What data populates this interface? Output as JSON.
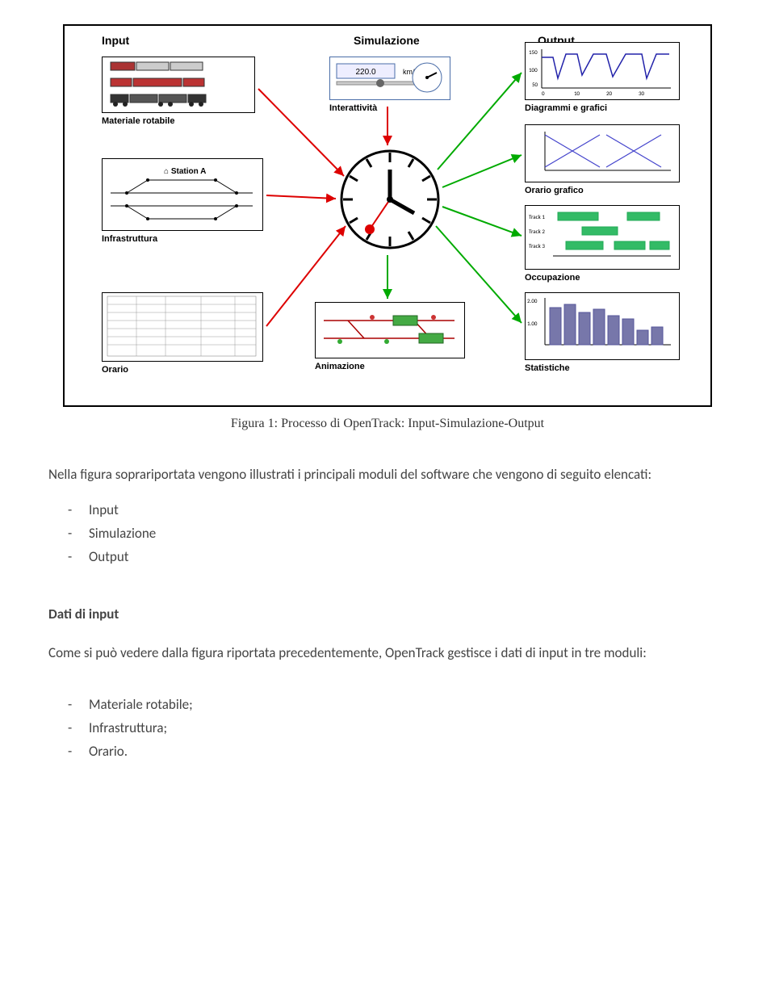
{
  "diagram": {
    "columns": {
      "input": "Input",
      "sim": "Simulazione",
      "output": "Output"
    },
    "input_boxes": {
      "rolling": "Materiale rotabile",
      "infra": "Infrastruttura",
      "infra_station": "Station A",
      "timetable": "Orario"
    },
    "sim_boxes": {
      "inter": "Interattività",
      "speed_value": "220.0",
      "speed_unit": "km/h",
      "anim": "Animazione"
    },
    "output_boxes": {
      "diag": "Diagrammi e grafici",
      "graf": "Orario grafico",
      "occ": "Occupazione",
      "stat": "Statistiche"
    }
  },
  "caption": "Figura 1: Processo di OpenTrack: Input-Simulazione-Output",
  "intro": "Nella figura soprariportata vengono illustrati i principali moduli del software che vengono di seguito elencati:",
  "modules": [
    "Input",
    "Simulazione",
    "Output"
  ],
  "section_heading": "Dati di input",
  "section_text_1": "Come si può vedere dalla figura riportata precedentemente, OpenTrack gestisce i dati di input in tre moduli:",
  "input_modules": [
    "Materiale rotabile;",
    "Infrastruttura;",
    "Orario."
  ]
}
